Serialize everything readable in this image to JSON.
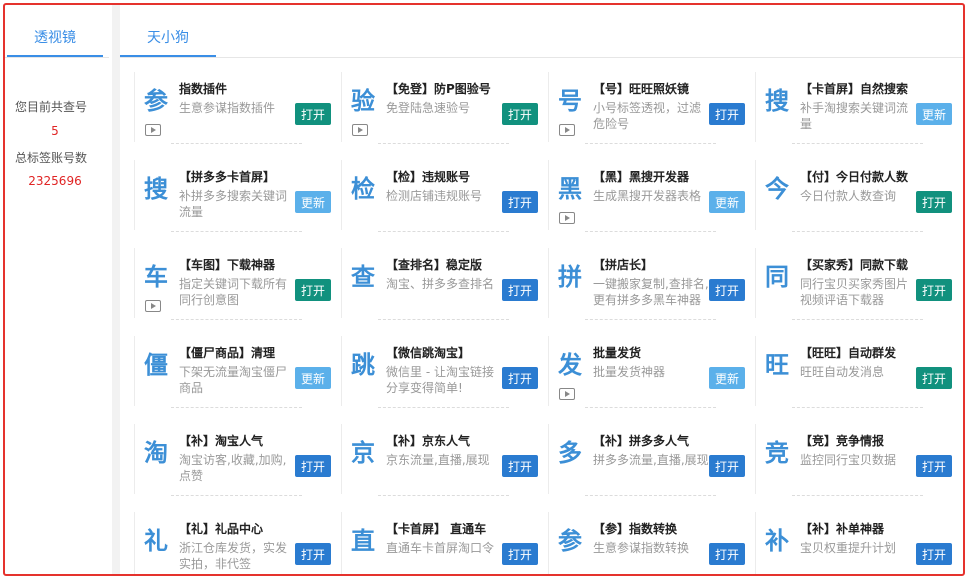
{
  "left": {
    "tab": "透视镜",
    "query_label": "您目前共查号",
    "query_count": "5",
    "total_label": "总标签账号数",
    "total_count": "2325696"
  },
  "main": {
    "tab": "天小狗"
  },
  "tools": [
    {
      "glyph": "参",
      "title": "指数插件",
      "desc": "生意参谋指数插件",
      "button": "打开",
      "style": "teal",
      "video": true
    },
    {
      "glyph": "验",
      "title": "【免登】防P图验号",
      "desc": "免登陆急速验号",
      "button": "打开",
      "style": "teal",
      "video": true
    },
    {
      "glyph": "号",
      "title": "【号】旺旺照妖镜",
      "desc": "小号标签透视，过滤危险号",
      "button": "打开",
      "style": "blue",
      "video": true
    },
    {
      "glyph": "搜",
      "title": "【卡首屏】自然搜索",
      "desc": "补手淘搜索关键词流量",
      "button": "更新",
      "style": "light",
      "video": false
    },
    {
      "glyph": "搜",
      "title": "【拼多多卡首屏】",
      "desc": "补拼多多搜索关键词流量",
      "button": "更新",
      "style": "light",
      "video": false
    },
    {
      "glyph": "检",
      "title": "【检】违规账号",
      "desc": "检测店铺违规账号",
      "button": "打开",
      "style": "blue",
      "video": false
    },
    {
      "glyph": "黑",
      "title": "【黑】黑搜开发器",
      "desc": "生成黑搜开发器表格",
      "button": "更新",
      "style": "light",
      "video": true
    },
    {
      "glyph": "今",
      "title": "【付】今日付款人数",
      "desc": "今日付款人数查询",
      "button": "打开",
      "style": "teal",
      "video": false
    },
    {
      "glyph": "车",
      "title": "【车图】下载神器",
      "desc": "指定关键词下载所有同行创意图",
      "button": "打开",
      "style": "teal",
      "video": true
    },
    {
      "glyph": "查",
      "title": "【查排名】稳定版",
      "desc": "淘宝、拼多多查排名",
      "button": "打开",
      "style": "blue",
      "video": false
    },
    {
      "glyph": "拼",
      "title": "【拼店长】",
      "desc": "一键搬家复制,查排名,更有拼多多黑车神器",
      "button": "打开",
      "style": "blue",
      "video": false
    },
    {
      "glyph": "同",
      "title": "【买家秀】同款下载",
      "desc": "同行宝贝买家秀图片视频评语下载器",
      "button": "打开",
      "style": "teal",
      "video": false
    },
    {
      "glyph": "僵",
      "title": "【僵尸商品】清理",
      "desc": "下架无流量淘宝僵尸商品",
      "button": "更新",
      "style": "light",
      "video": false
    },
    {
      "glyph": "跳",
      "title": "【微信跳淘宝】",
      "desc": "微信里 - 让淘宝链接分享变得简单!",
      "button": "打开",
      "style": "blue",
      "video": false
    },
    {
      "glyph": "发",
      "title": "批量发货",
      "desc": "批量发货神器",
      "button": "更新",
      "style": "light",
      "video": true
    },
    {
      "glyph": "旺",
      "title": "【旺旺】自动群发",
      "desc": "旺旺自动发消息",
      "button": "打开",
      "style": "teal",
      "video": false
    },
    {
      "glyph": "淘",
      "title": "【补】淘宝人气",
      "desc": "淘宝访客,收藏,加购,点赞",
      "button": "打开",
      "style": "blue",
      "video": false
    },
    {
      "glyph": "京",
      "title": "【补】京东人气",
      "desc": "京东流量,直播,展现",
      "button": "打开",
      "style": "blue",
      "video": false
    },
    {
      "glyph": "多",
      "title": "【补】拼多多人气",
      "desc": "拼多多流量,直播,展现",
      "button": "打开",
      "style": "blue",
      "video": false
    },
    {
      "glyph": "竞",
      "title": "【竞】竞争情报",
      "desc": "监控同行宝贝数据",
      "button": "打开",
      "style": "blue",
      "video": false
    },
    {
      "glyph": "礼",
      "title": "【礼】礼品中心",
      "desc": "浙江仓库发货，实发实拍，非代签",
      "button": "打开",
      "style": "blue",
      "video": false
    },
    {
      "glyph": "直",
      "title": "【卡首屏】 直通车",
      "desc": "直通车卡首屏淘口令",
      "button": "打开",
      "style": "blue",
      "video": false
    },
    {
      "glyph": "参",
      "title": "【参】指数转换",
      "desc": "生意参谋指数转换",
      "button": "打开",
      "style": "blue",
      "video": false
    },
    {
      "glyph": "补",
      "title": "【补】补单神器",
      "desc": "宝贝权重提升计划",
      "button": "打开",
      "style": "blue",
      "video": false
    }
  ]
}
